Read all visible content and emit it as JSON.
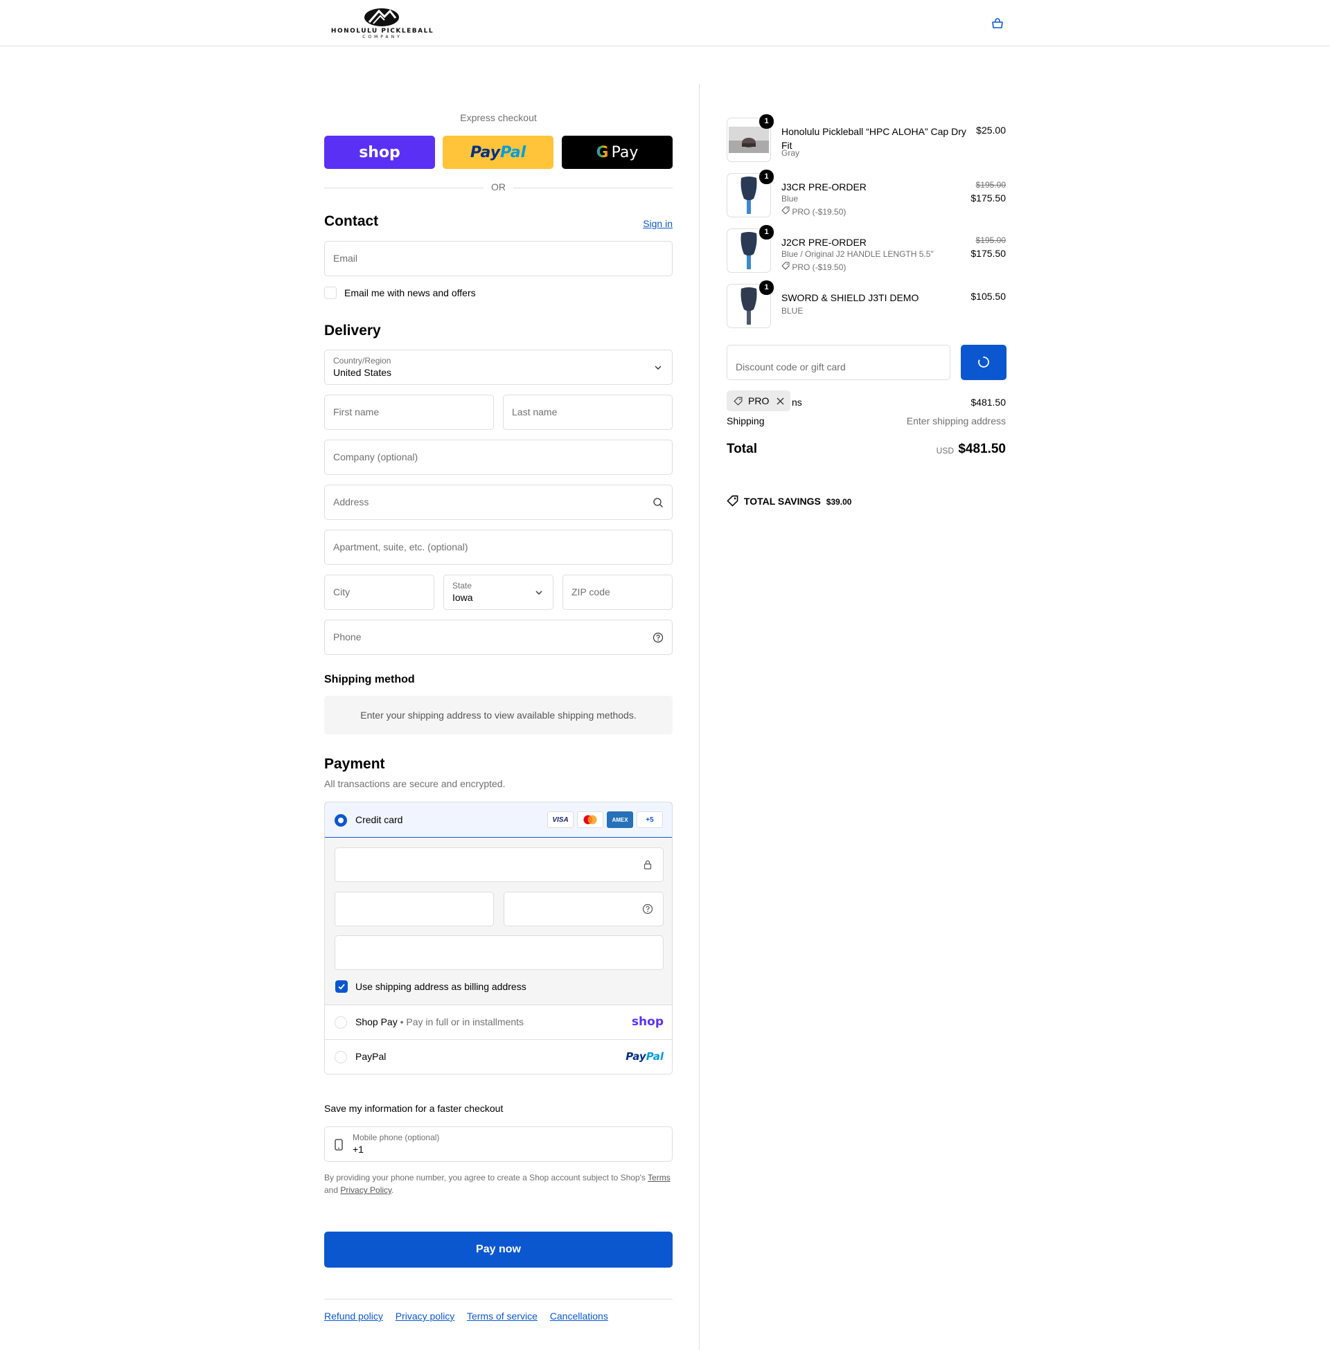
{
  "brand": {
    "logo_line1": "HONOLULU PICKLEBALL",
    "logo_line2": "COMPANY"
  },
  "express": {
    "label": "Express checkout",
    "shop_label": "shop",
    "paypal_label_1": "Pay",
    "paypal_label_2": "Pal",
    "gpay_g": "G",
    "gpay_label": "Pay",
    "or_label": "OR"
  },
  "contact": {
    "title": "Contact",
    "sign_in": "Sign in",
    "email_placeholder": "Email",
    "newsletter_label": "Email me with news and offers",
    "newsletter_checked": false
  },
  "delivery": {
    "title": "Delivery",
    "country_label": "Country/Region",
    "country_value": "United States",
    "first_name_placeholder": "First name",
    "last_name_placeholder": "Last name",
    "company_placeholder": "Company (optional)",
    "address_placeholder": "Address",
    "apartment_placeholder": "Apartment, suite, etc. (optional)",
    "city_placeholder": "City",
    "state_label": "State",
    "state_value": "Iowa",
    "zip_placeholder": "ZIP code",
    "phone_placeholder": "Phone"
  },
  "shipping_method": {
    "title": "Shipping method",
    "note": "Enter your shipping address to view available shipping methods."
  },
  "payment": {
    "title": "Payment",
    "subtitle": "All transactions are secure and encrypted.",
    "credit_card_label": "Credit card",
    "card_logos": [
      "VISA",
      "MC",
      "AMEX",
      "+5"
    ],
    "billing_same_label": "Use shipping address as billing address",
    "billing_same_checked": true,
    "shop_pay_label": "Shop Pay",
    "shop_pay_sub": "Pay in full or in installments",
    "shop_pay_logo": "shop",
    "paypal_label": "PayPal",
    "paypal_logo_1": "Pay",
    "paypal_logo_2": "Pal"
  },
  "save_info": {
    "title": "Save my information for a faster checkout",
    "mobile_label": "Mobile phone (optional)",
    "mobile_value": "+1",
    "legal_1": "By providing your phone number, you agree to create a Shop account subject to Shop's",
    "legal_terms": "Terms",
    "legal_2": "and",
    "legal_privacy": "Privacy Policy",
    "legal_3": "."
  },
  "pay_now_label": "Pay now",
  "footer_links": [
    "Refund policy",
    "Privacy policy",
    "Terms of service",
    "Cancellations"
  ],
  "order": {
    "items": [
      {
        "qty": "1",
        "name": "Honolulu Pickleball “HPC ALOHA” Cap Dry Fit",
        "variant": "Gray",
        "price": "$25.00"
      },
      {
        "qty": "1",
        "name": "J3CR PRE-ORDER",
        "variant": "Blue",
        "discount": "PRO (-$19.50)",
        "old_price": "$195.00",
        "price": "$175.50"
      },
      {
        "qty": "1",
        "name": "J2CR PRE-ORDER",
        "variant": "Blue / Original J2 HANDLE LENGTH 5.5\"",
        "discount": "PRO (-$19.50)",
        "old_price": "$195.00",
        "price": "$175.50"
      },
      {
        "qty": "1",
        "name": "SWORD & SHIELD J3TI DEMO",
        "variant": "BLUE",
        "price": "$105.50"
      }
    ],
    "discount_placeholder": "Discount code or gift card",
    "applied_code": "PRO",
    "subtotal_partial_label": "ns",
    "subtotal_value": "$481.50",
    "shipping_label": "Shipping",
    "shipping_value": "Enter shipping address",
    "total_label": "Total",
    "total_currency": "USD",
    "total_value": "$481.50",
    "savings_label": "TOTAL SAVINGS",
    "savings_value": "$39.00"
  },
  "colors": {
    "accent": "#0b57d0",
    "shop_purple": "#5a31f4",
    "paypal_yellow": "#ffc439"
  }
}
